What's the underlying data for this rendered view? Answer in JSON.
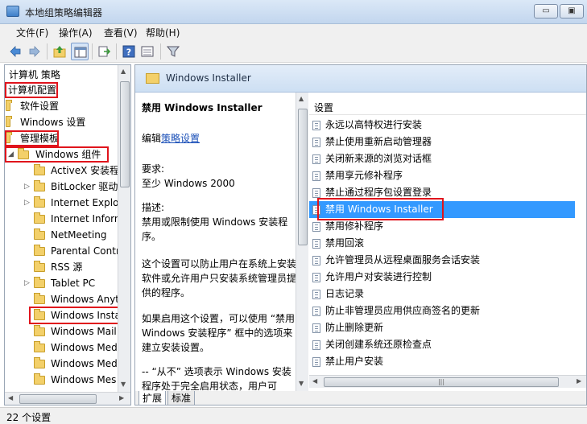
{
  "window": {
    "title": "本地组策略编辑器",
    "min_glyph": "▭",
    "max_glyph": "▣"
  },
  "menu": [
    "文件(F)",
    "操作(A)",
    "查看(V)",
    "帮助(H)"
  ],
  "toolbar": {
    "icons": [
      "back-arrow-icon",
      "forward-arrow-icon",
      "up-folder-icon",
      "show-hide-tree-icon",
      "export-list-icon",
      "help-icon",
      "properties-view-icon",
      "filter-icon"
    ]
  },
  "tree": {
    "items": [
      {
        "label": "计算机 策略",
        "folder": false,
        "arrow": ""
      },
      {
        "label": "计算机配置",
        "folder": false,
        "arrow": ""
      },
      {
        "label": "软件设置",
        "folder": true,
        "arrow": ""
      },
      {
        "label": "Windows 设置",
        "folder": true,
        "arrow": ""
      },
      {
        "label": "管理模板",
        "folder": true,
        "arrow": ""
      },
      {
        "label": "Windows 组件",
        "folder": true,
        "arrow": "◢"
      },
      {
        "label": "ActiveX 安装程",
        "folder": true,
        "arrow": ""
      },
      {
        "label": "BitLocker 驱动",
        "folder": true,
        "arrow": "▷"
      },
      {
        "label": "Internet Explor",
        "folder": true,
        "arrow": "▷"
      },
      {
        "label": "Internet Inforn",
        "folder": true,
        "arrow": ""
      },
      {
        "label": "NetMeeting",
        "folder": true,
        "arrow": ""
      },
      {
        "label": "Parental Contr",
        "folder": true,
        "arrow": ""
      },
      {
        "label": "RSS 源",
        "folder": true,
        "arrow": ""
      },
      {
        "label": "Tablet PC",
        "folder": true,
        "arrow": "▷"
      },
      {
        "label": "Windows Anyt",
        "folder": true,
        "arrow": ""
      },
      {
        "label": "Windows Insta",
        "folder": true,
        "arrow": ""
      },
      {
        "label": "Windows Mail",
        "folder": true,
        "arrow": ""
      },
      {
        "label": "Windows Med",
        "folder": true,
        "arrow": ""
      },
      {
        "label": "Windows Med",
        "folder": true,
        "arrow": ""
      },
      {
        "label": "Windows Mes",
        "folder": true,
        "arrow": ""
      }
    ]
  },
  "right": {
    "header": "Windows Installer",
    "desc": {
      "title": "禁用 Windows Installer",
      "edit_prefix": "编辑",
      "edit_link": "策略设置",
      "req_label": "要求:",
      "req_value": "至少 Windows 2000",
      "desc_label": "描述:",
      "desc_text": "禁用或限制使用 Windows 安装程序。",
      "para2": "这个设置可以防止用户在系统上安装软件或允许用户只安装系统管理员提供的程序。",
      "para3": "如果启用这个设置，可以使用 “禁用 Windows 安装程序” 框中的选项来建立安装设置。",
      "para4": "-- “从不” 选项表示 Windows 安装程序处于完全启用状态，用户可"
    },
    "list_header": "设置",
    "settings": [
      "永远以高特权进行安装",
      "禁止使用重新启动管理器",
      "关闭新来源的浏览对话框",
      "禁用享元修补程序",
      "禁止通过程序包设置登录",
      "禁用 Windows Installer",
      "禁用修补程序",
      "禁用回滚",
      "允许管理员从远程桌面服务会话安装",
      "允许用户对安装进行控制",
      "日志记录",
      "防止非管理员应用供应商签名的更新",
      "防止删除更新",
      "关闭创建系统还原检查点",
      "禁止用户安装"
    ],
    "tabs": [
      "扩展",
      "标准"
    ]
  },
  "status": "22 个设置",
  "scroll": {
    "up": "▲",
    "down": "▼",
    "left": "◀",
    "right": "▶",
    "grip": "|||"
  },
  "colors": {
    "highlight_box": "#e0141c",
    "selection": "#3399ff"
  }
}
